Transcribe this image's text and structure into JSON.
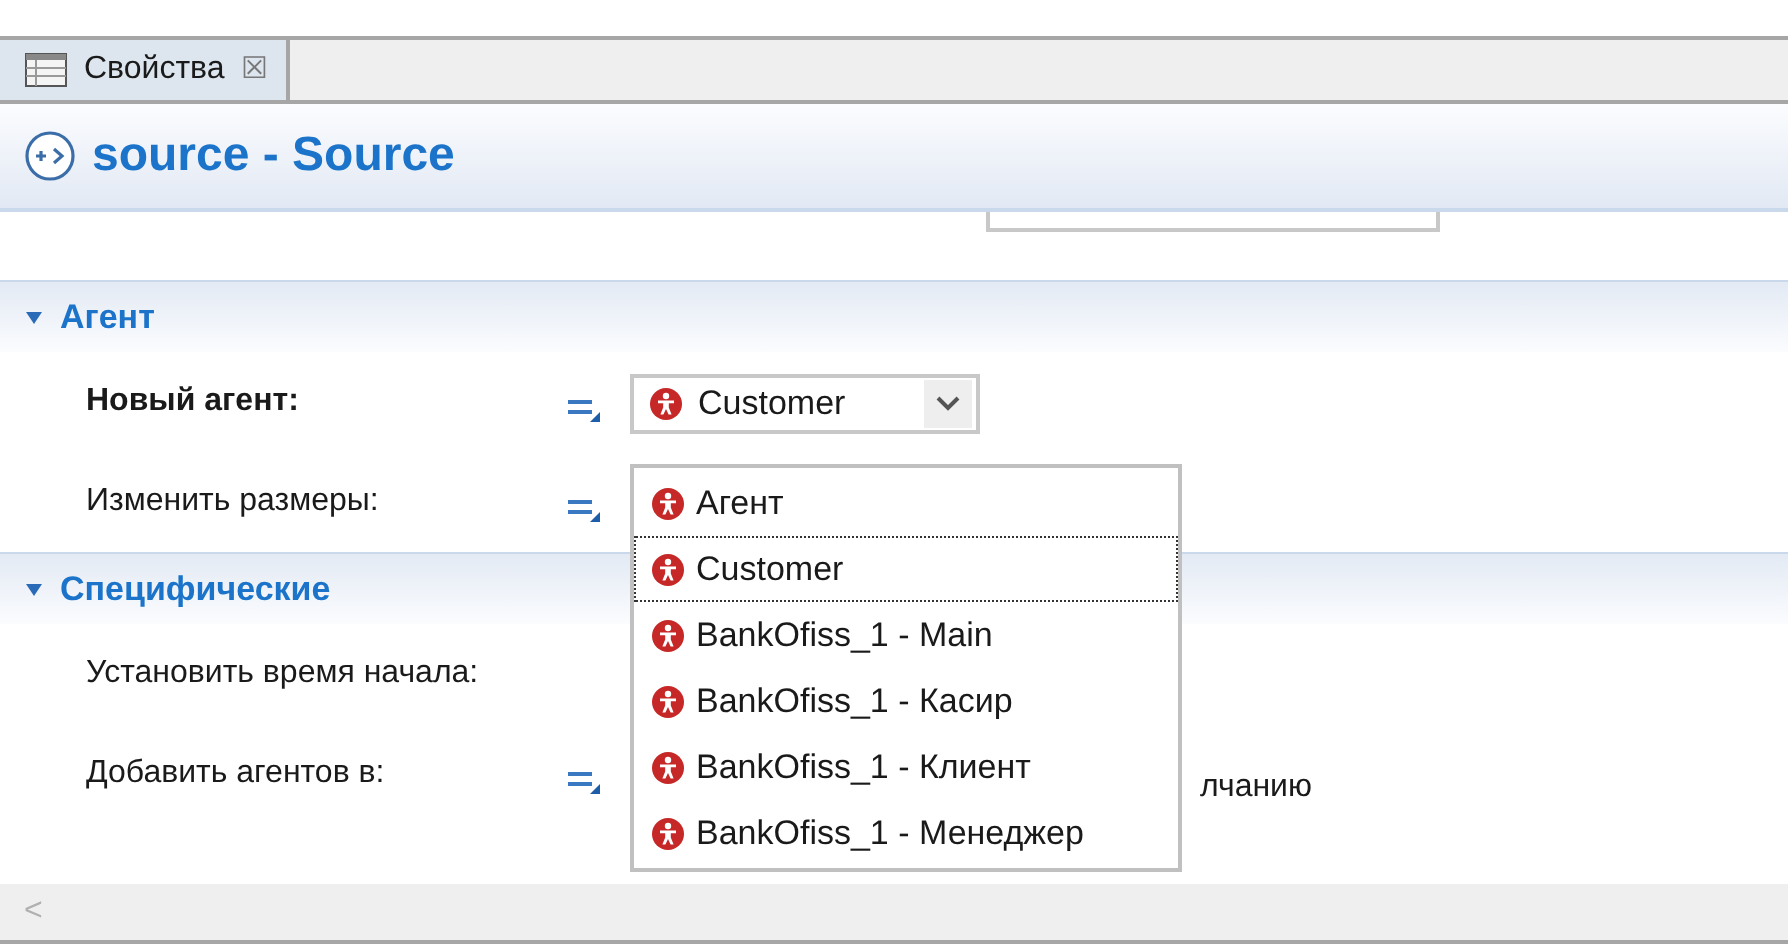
{
  "tabs": [
    {
      "label": "Свойства",
      "selected": true,
      "close": "☒"
    }
  ],
  "header": {
    "title": "source - Source"
  },
  "sections": [
    {
      "title": "Агент",
      "expanded": true,
      "rows": [
        {
          "label": "Новый агент:",
          "bold": true,
          "kind": "combo",
          "value": "Customer"
        },
        {
          "label": "Изменить размеры:",
          "bold": false,
          "kind": "blank"
        }
      ]
    },
    {
      "title": "Специфические",
      "expanded": true,
      "rows": [
        {
          "label": "Установить время начала:",
          "bold": false,
          "kind": "blank"
        },
        {
          "label": "Добавить агентов в:",
          "bold": false,
          "kind": "radio",
          "value": "лчанию"
        }
      ]
    }
  ],
  "dropdown": {
    "items": [
      {
        "label": "Агент",
        "selected": false
      },
      {
        "label": "Customer",
        "selected": true
      },
      {
        "label": "BankOfiss_1 - Main",
        "selected": false
      },
      {
        "label": "BankOfiss_1 - Касир",
        "selected": false
      },
      {
        "label": "BankOfiss_1 - Клиент",
        "selected": false
      },
      {
        "label": "BankOfiss_1 - Менеджер",
        "selected": false
      }
    ]
  },
  "scrollbar": {
    "left_arrow": "<"
  }
}
